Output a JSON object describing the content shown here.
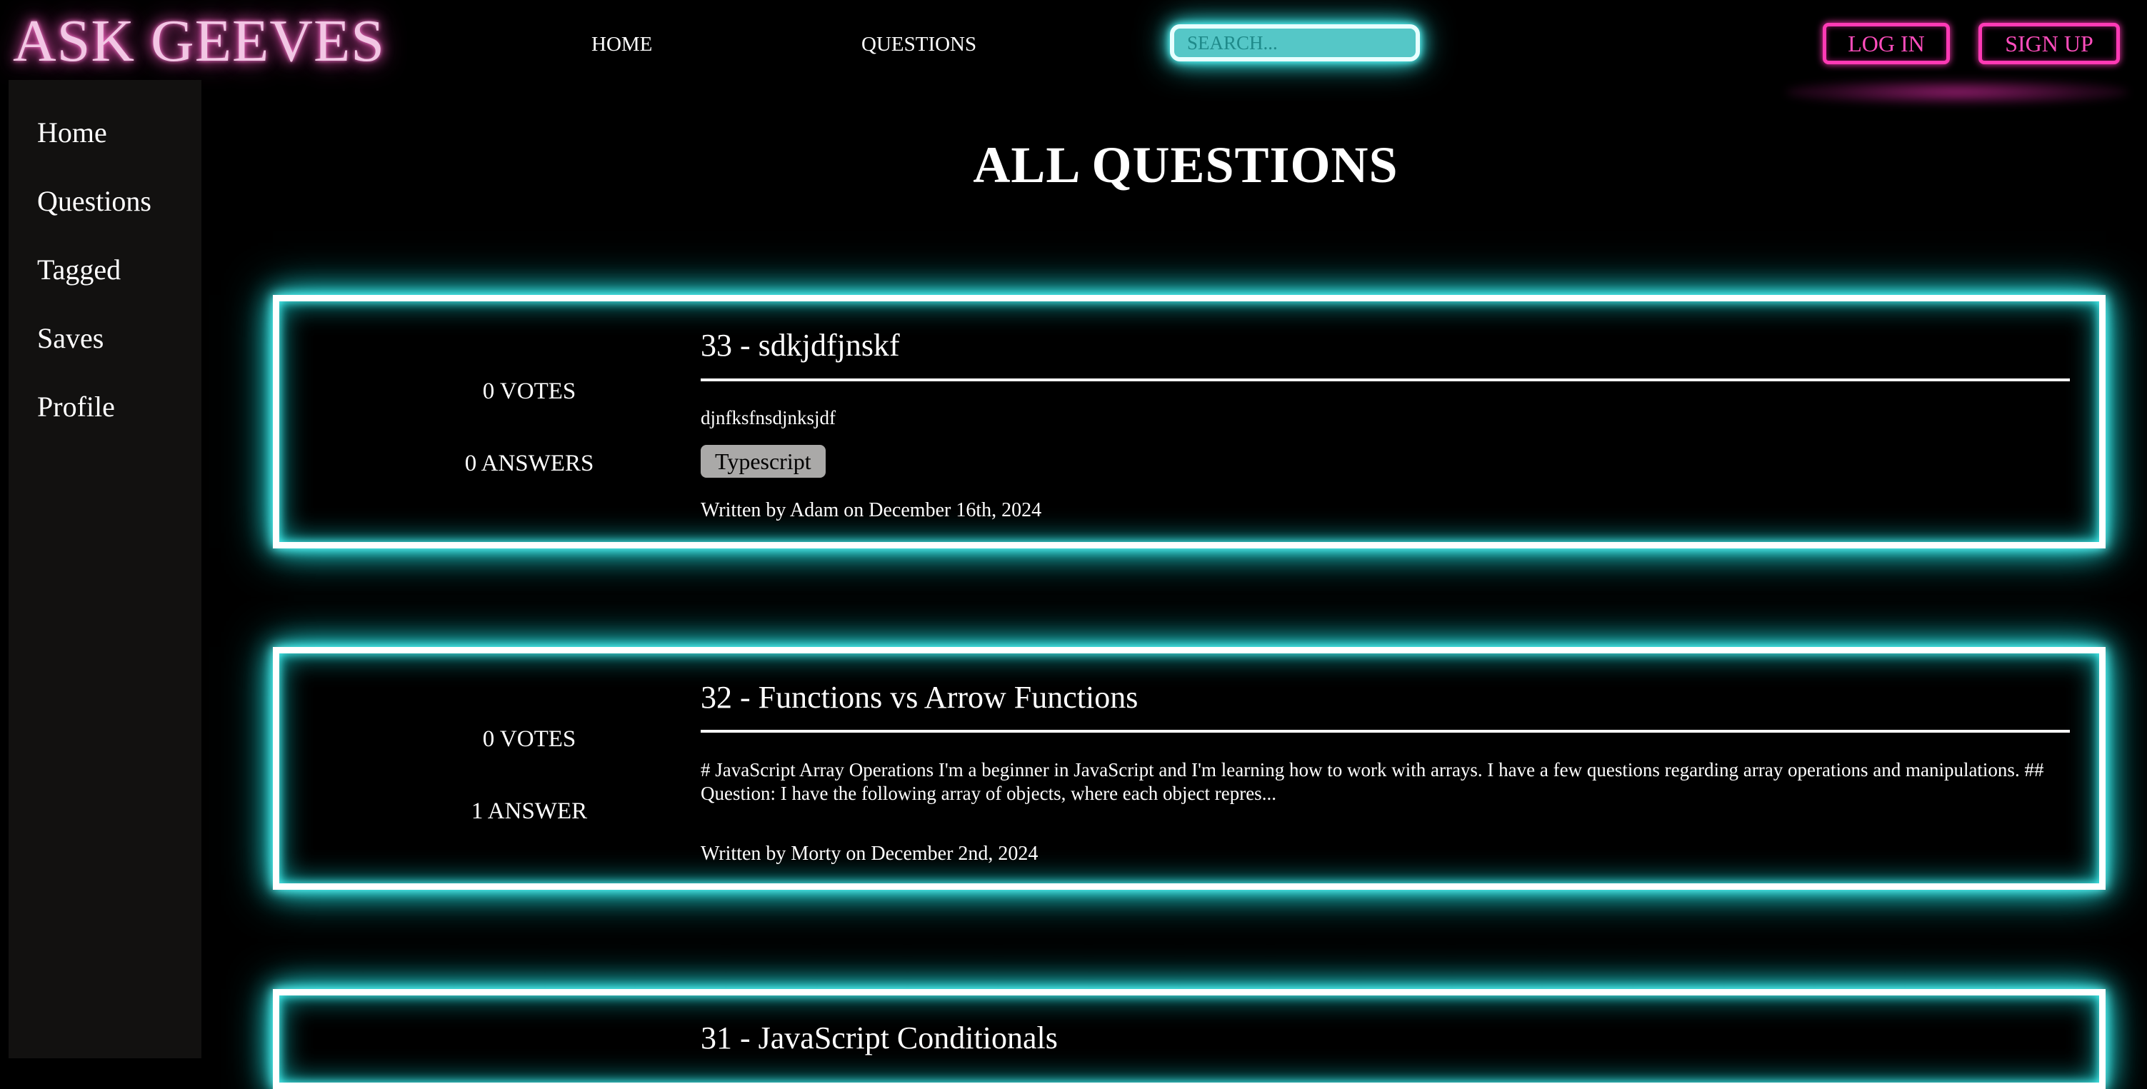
{
  "header": {
    "logo": "ASK GEEVES",
    "nav": {
      "home": "HOME",
      "questions": "QUESTIONS"
    },
    "search": {
      "placeholder": "SEARCH..."
    },
    "login_label": "LOG IN",
    "signup_label": "SIGN UP"
  },
  "sidebar": {
    "items": [
      {
        "label": "Home"
      },
      {
        "label": "Questions"
      },
      {
        "label": "Tagged"
      },
      {
        "label": "Saves"
      },
      {
        "label": "Profile"
      }
    ]
  },
  "main": {
    "title": "ALL QUESTIONS",
    "questions": [
      {
        "title": "33 - sdkjdfjnskf",
        "votes": "0 VOTES",
        "answers": "0 ANSWERS",
        "body": "djnfksfnsdjnksjdf",
        "tag": "Typescript",
        "meta": "Written by Adam on December 16th, 2024"
      },
      {
        "title": "32 - Functions vs Arrow Functions",
        "votes": "0 VOTES",
        "answers": "1 ANSWER",
        "body": "# JavaScript Array Operations I'm a beginner in JavaScript and I'm learning how to work with arrays. I have a few questions regarding array operations and manipulations. ## Question: I have the following array of objects, where each object repres...",
        "meta": "Written by Morty on December 2nd, 2024"
      },
      {
        "title": "31 - JavaScript Conditionals"
      }
    ]
  },
  "colors": {
    "accent_cyan": "#66ffff",
    "accent_pink": "#ff3ab5",
    "logo_pink": "#f2c6e4",
    "sidebar_bg": "#121110",
    "tag_bg": "#aaa9a8"
  }
}
